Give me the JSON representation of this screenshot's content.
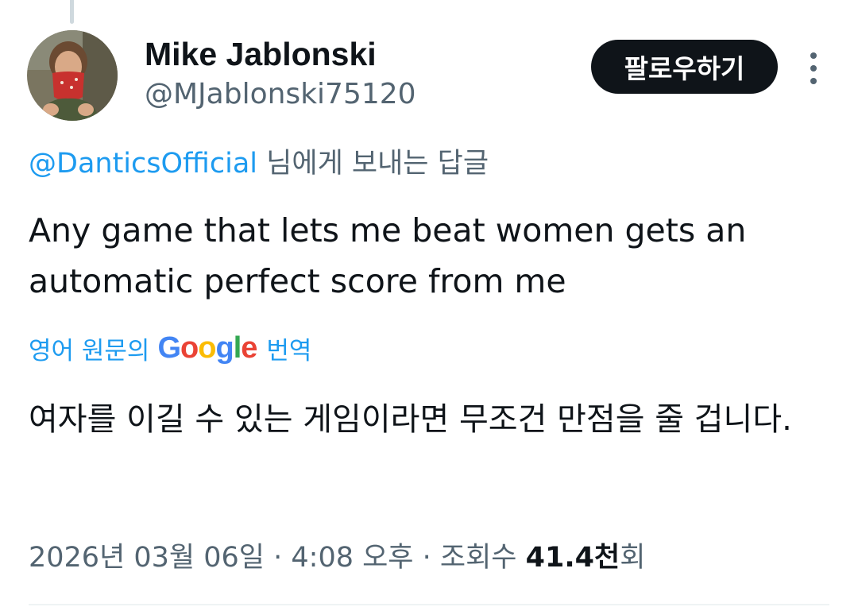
{
  "author": {
    "display_name": "Mike Jablonski",
    "handle": "@MJablonski75120"
  },
  "actions": {
    "follow_label": "팔로우하기",
    "more_icon": "more-vertical-icon"
  },
  "reply_context": {
    "mention": "@DanticsOfficial",
    "suffix": " 님에게 보내는 답글"
  },
  "tweet": {
    "text": "Any game that lets me beat women gets an automatic perfect score from me",
    "translation_prefix": "영어 원문의",
    "translation_brand": "Google",
    "translation_suffix": "번역",
    "translated_text": "여자를 이길 수 있는 게임이라면 무조건 만점을 줄 겁니다."
  },
  "meta": {
    "date": "2026년 03월 06일",
    "separator1": " · ",
    "time": "4:08 오후",
    "separator2": " · ",
    "views_label": "조회수 ",
    "views_count": "41.4천",
    "views_suffix": "회"
  },
  "colors": {
    "link": "#1d9bf0",
    "secondary_text": "#536471",
    "primary_text": "#0f1419",
    "button_bg": "#0f1419"
  }
}
